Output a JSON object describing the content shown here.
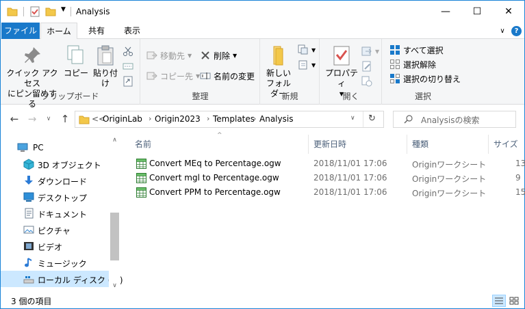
{
  "window": {
    "title": "Analysis",
    "minimize": "—",
    "maximize": "☐",
    "close": "✕"
  },
  "tabs": {
    "file": "ファイル",
    "home": "ホーム",
    "share": "共有",
    "view": "表示",
    "collapse": "∨",
    "help": "?"
  },
  "ribbon": {
    "clipboard": {
      "label": "クリップボード",
      "pin_line1": "クイック アクセス",
      "pin_line2": "にピン留めする",
      "copy": "コピー",
      "paste": "貼り付け"
    },
    "organize": {
      "label": "整理",
      "move_to": "移動先",
      "copy_to": "コピー先",
      "delete": "削除",
      "rename": "名前の変更"
    },
    "new": {
      "label": "新規",
      "new_folder_line1": "新しい",
      "new_folder_line2": "フォルダー"
    },
    "open": {
      "label": "開く",
      "properties": "プロパティ"
    },
    "select": {
      "label": "選択",
      "select_all": "すべて選択",
      "select_none": "選択解除",
      "invert": "選択の切り替え"
    }
  },
  "address": {
    "overflow": "<<",
    "crumbs": [
      "OriginLab",
      "Origin2023",
      "Templates",
      "Analysis"
    ],
    "search_placeholder": "Analysisの検索"
  },
  "nav": {
    "items": [
      {
        "label": "PC",
        "icon": "pc-icon"
      },
      {
        "label": "3D オブジェクト",
        "icon": "3d-objects-icon"
      },
      {
        "label": "ダウンロード",
        "icon": "download-icon"
      },
      {
        "label": "デスクトップ",
        "icon": "desktop-icon"
      },
      {
        "label": "ドキュメント",
        "icon": "documents-icon"
      },
      {
        "label": "ピクチャ",
        "icon": "pictures-icon"
      },
      {
        "label": "ビデオ",
        "icon": "videos-icon"
      },
      {
        "label": "ミュージック",
        "icon": "music-icon"
      },
      {
        "label": "ローカル ディスク (C:)",
        "icon": "local-disk-icon"
      }
    ]
  },
  "list": {
    "columns": {
      "name": "名前",
      "date": "更新日時",
      "type": "種類",
      "size": "サイズ"
    },
    "rows": [
      {
        "name": "Convert MEq to Percentage.ogw",
        "date": "2018/11/01 17:06",
        "type": "Originワークシート",
        "size": "13"
      },
      {
        "name": "Convert mgl to Percentage.ogw",
        "date": "2018/11/01 17:06",
        "type": "Originワークシート",
        "size": "9"
      },
      {
        "name": "Convert PPM to Percentage.ogw",
        "date": "2018/11/01 17:06",
        "type": "Originワークシート",
        "size": "15"
      }
    ]
  },
  "status": {
    "count": "3 個の項目"
  },
  "colors": {
    "accent": "#1979ca",
    "selected": "#cce8ff",
    "folder": "#f3c84a"
  }
}
